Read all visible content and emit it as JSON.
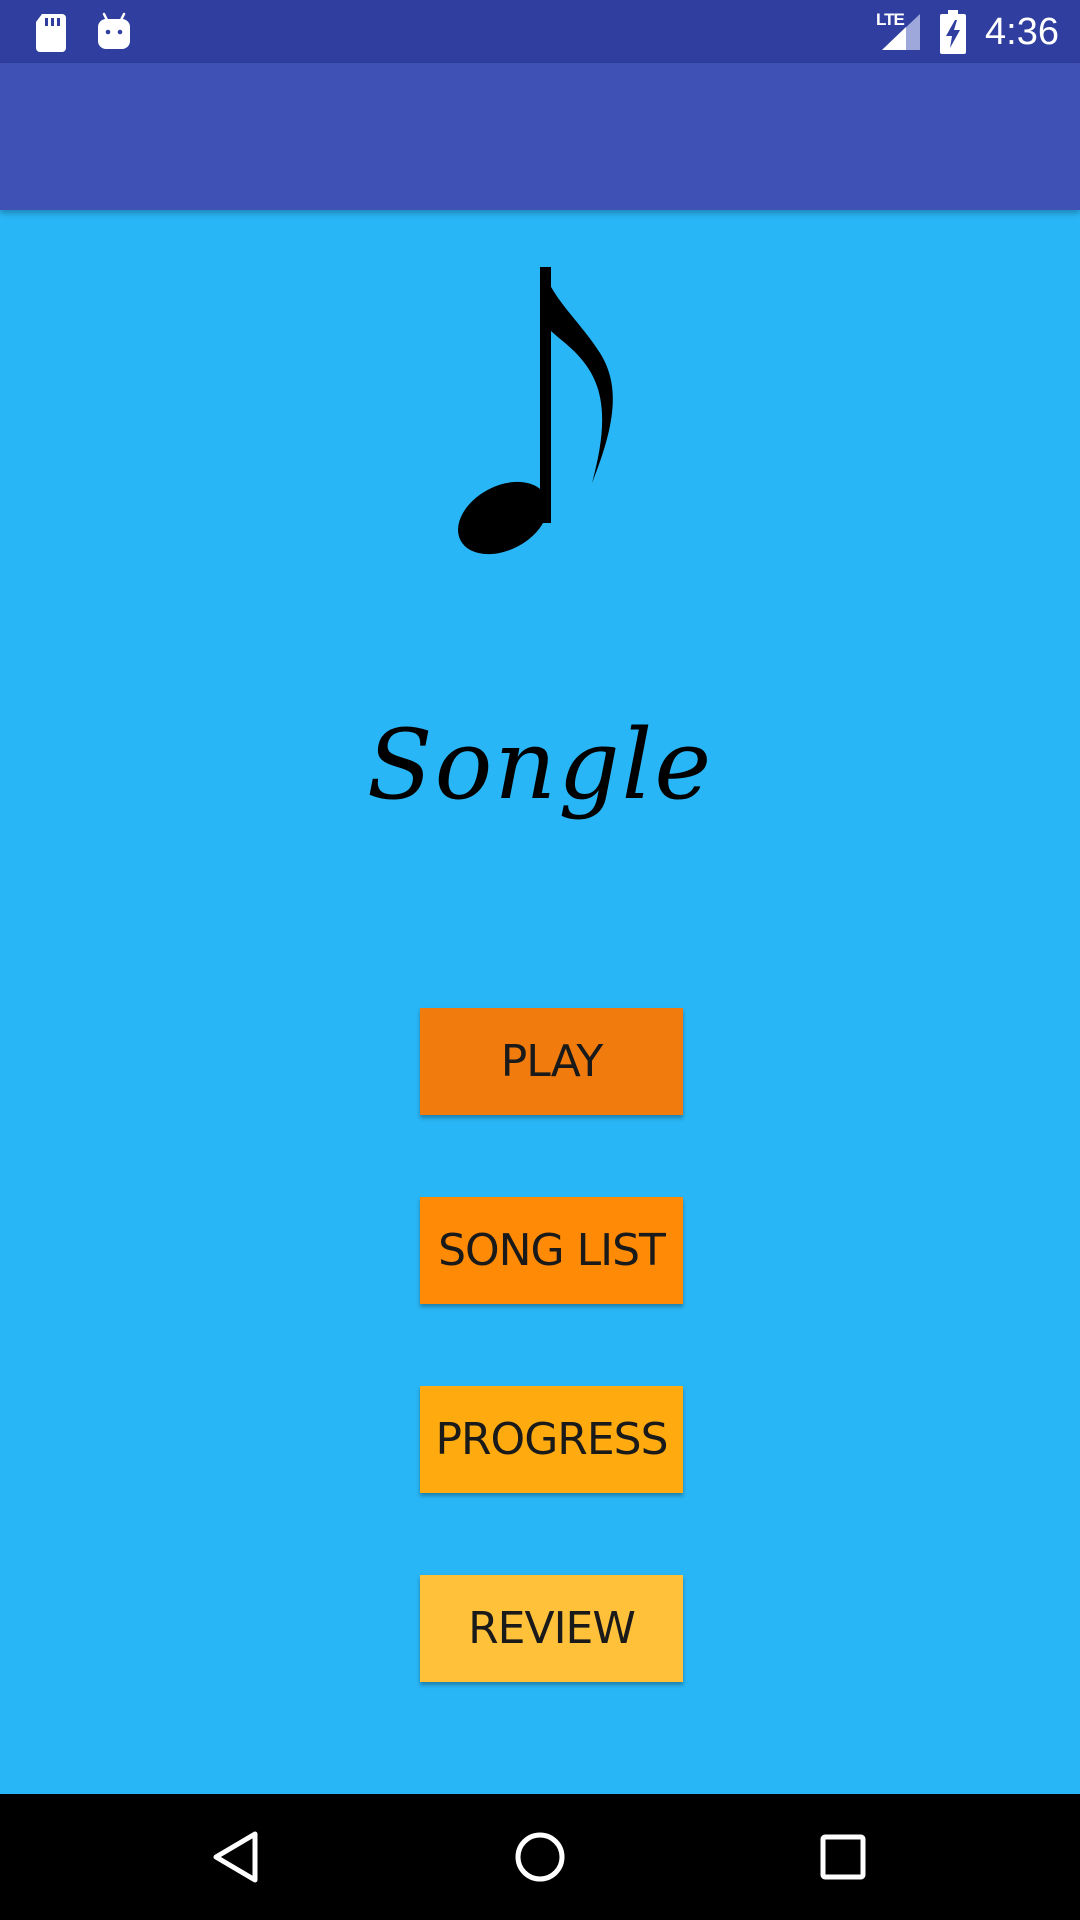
{
  "status_bar": {
    "time": "4:36",
    "network": "LTE",
    "left_icons": [
      "sd-card-icon",
      "android-icon"
    ],
    "right_icons": [
      "signal-icon",
      "battery-charging-icon"
    ]
  },
  "app": {
    "title": "Songle",
    "logo_icon": "music-note-icon",
    "background_color": "#29b6f6",
    "toolbar_color": "#3f51b5",
    "statusbar_color": "#303f9f"
  },
  "menu": {
    "play_label": "PLAY",
    "song_list_label": "SONG LIST",
    "progress_label": "PROGRESS",
    "review_label": "REVIEW",
    "colors": [
      "#f17b0d",
      "#ff8a05",
      "#ffab10",
      "#ffc03a"
    ]
  },
  "nav_bar": {
    "icons": [
      "back-icon",
      "home-icon",
      "recents-icon"
    ]
  }
}
